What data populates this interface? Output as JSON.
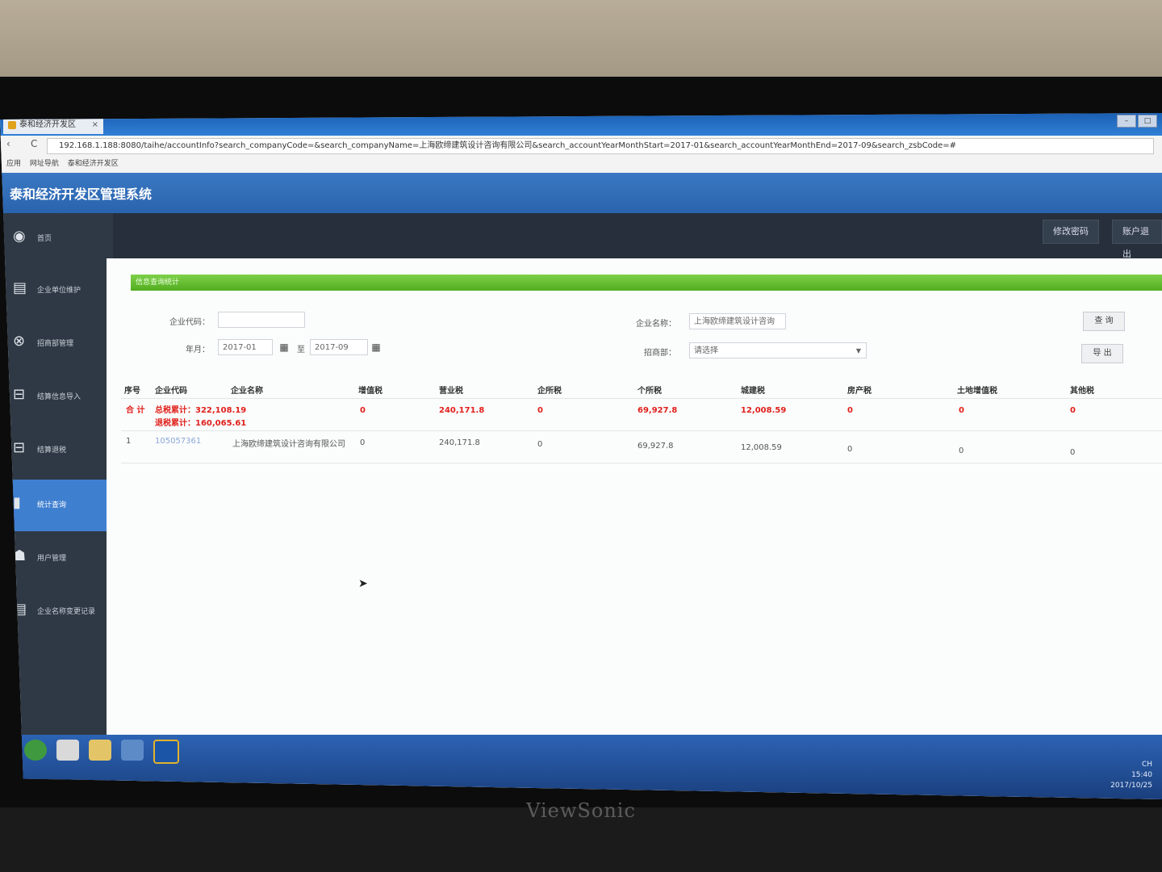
{
  "browser": {
    "tab_title": "泰和经济开发区",
    "tab_close": "×",
    "url": "192.168.1.188:8080/taihe/accountInfo?search_companyCode=&search_companyName=上海欧缔建筑设计咨询有限公司&search_accountYearMonthStart=2017-01&search_accountYearMonthEnd=2017-09&search_zsbCode=#",
    "bookmarks": [
      "应用",
      "网址导航",
      "泰和经济开发区"
    ],
    "back_icon": "‹",
    "reload_icon": "C"
  },
  "app": {
    "title": "泰和经济开发区管理系统",
    "top_buttons": {
      "change_password": "修改密码",
      "logout": "账户退出"
    }
  },
  "sidebar": {
    "items": [
      {
        "label": "首页",
        "icon": "user-circle-icon",
        "glyph": "◉"
      },
      {
        "label": "企业单位维护",
        "icon": "document-icon",
        "glyph": "▤"
      },
      {
        "label": "招商部管理",
        "icon": "globe-icon",
        "glyph": "⊗"
      },
      {
        "label": "结算信息导入",
        "icon": "inbox-icon",
        "glyph": "⊟"
      },
      {
        "label": "结算退税",
        "icon": "inbox-icon",
        "glyph": "⊟"
      },
      {
        "label": "统计查询",
        "icon": "bar-chart-icon",
        "glyph": "▮"
      },
      {
        "label": "用户管理",
        "icon": "users-icon",
        "glyph": "☗"
      },
      {
        "label": "企业名称变更记录",
        "icon": "document-icon",
        "glyph": "▤"
      }
    ]
  },
  "panel": {
    "title": "信息查询统计"
  },
  "filters": {
    "company_code_label": "企业代码：",
    "company_code_value": "",
    "company_name_label": "企业名称：",
    "company_name_value": "上海欧缔建筑设计咨询",
    "year_label": "年月：",
    "start": "2017-01",
    "to": "至",
    "end": "2017-09",
    "zsb_label": "招商部：",
    "zsb_value": "请选择",
    "query_btn": "查 询",
    "export_btn": "导 出"
  },
  "table": {
    "headers": [
      "序号",
      "企业代码",
      "企业名称",
      "增值税",
      "营业税",
      "企所税",
      "个所税",
      "城建税",
      "房产税",
      "土地增值税",
      "其他税"
    ],
    "total_row": {
      "label": "合 计",
      "line1": "总税累计：322,108.19",
      "line2": "退税累计：160,065.61",
      "vat": "0",
      "business": "240,171.8",
      "corp": "0",
      "personal": "69,927.8",
      "urban": "12,008.59",
      "property": "0",
      "land": "0",
      "other": "0"
    },
    "rows": [
      {
        "no": "1",
        "code": "105057361",
        "name": "上海欧缔建筑设计咨询有限公司",
        "vat": "0",
        "business": "240,171.8",
        "corp": "0",
        "personal": "69,927.8",
        "urban": "12,008.59",
        "property": "0",
        "land": "0",
        "other": "0"
      }
    ]
  },
  "taskbar": {
    "time": "15:40",
    "date": "2017/10/25",
    "ime": "CH"
  },
  "monitor_brand": "ViewSonic"
}
